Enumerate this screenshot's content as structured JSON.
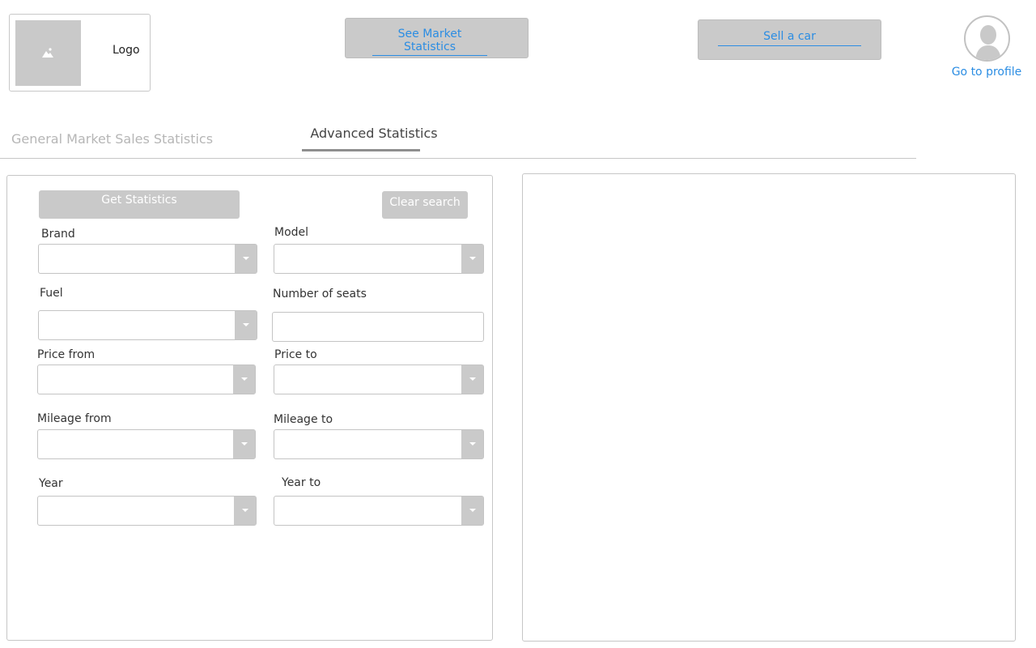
{
  "header": {
    "logo_text": "Logo",
    "market_button_label": "See Market Statistics",
    "sell_button_label": "Sell a car",
    "profile_link_label": "Go to profile"
  },
  "tabs": [
    {
      "label": "General Market Sales Statistics",
      "active": false
    },
    {
      "label": "Advanced Statistics",
      "active": true
    }
  ],
  "filters": {
    "get_statistics_label": "Get Statistics",
    "clear_search_label": "Clear search",
    "fields": {
      "brand": {
        "label": "Brand",
        "value": ""
      },
      "model": {
        "label": "Model",
        "value": ""
      },
      "fuel": {
        "label": "Fuel",
        "value": ""
      },
      "seats": {
        "label": "Number of seats",
        "value": ""
      },
      "price_from": {
        "label": "Price from",
        "value": ""
      },
      "price_to": {
        "label": "Price to",
        "value": ""
      },
      "mileage_from": {
        "label": "Mileage from",
        "value": ""
      },
      "mileage_to": {
        "label": "Mileage to",
        "value": ""
      },
      "year": {
        "label": "Year",
        "value": ""
      },
      "year_to": {
        "label": "Year to",
        "value": ""
      }
    }
  },
  "colors": {
    "link": "#2b8de3",
    "button_bg": "#cacaca",
    "border": "#c6c6c6"
  },
  "icons": {
    "logo": "image-placeholder-icon",
    "avatar": "user-avatar-icon",
    "dropdown": "chevron-down-icon"
  }
}
